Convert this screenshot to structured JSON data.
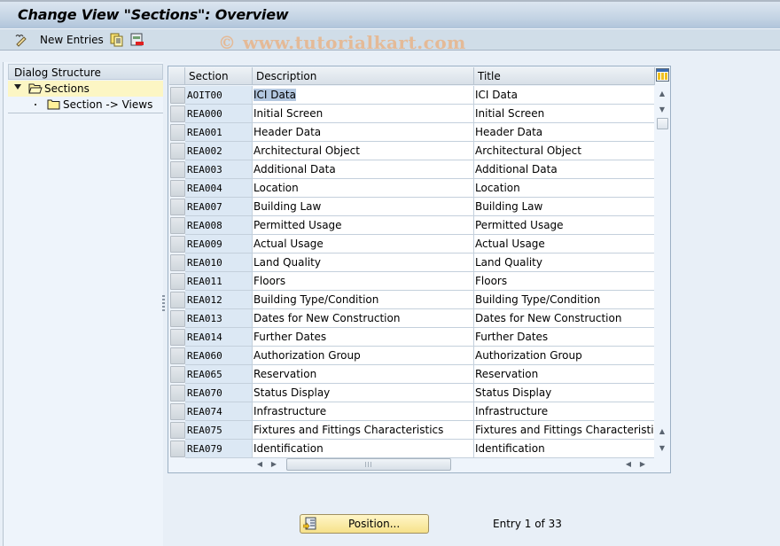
{
  "window": {
    "title": "Change View \"Sections\": Overview"
  },
  "toolbar": {
    "new_entries_label": "New Entries",
    "icons": [
      "edit-pencil-icon",
      "copy-icon",
      "delete-icon"
    ],
    "watermark": "© www.tutorialkart.com"
  },
  "dialog_structure": {
    "header": "Dialog Structure",
    "items": [
      {
        "label": "Sections",
        "icon": "open-folder-icon",
        "expanded": true,
        "selected": true
      },
      {
        "label": "Section -> Views",
        "icon": "folder-icon",
        "selected": false
      }
    ]
  },
  "table": {
    "columns": [
      "Section",
      "Description",
      "Title"
    ],
    "rows": [
      {
        "section": "AOIT00",
        "description": "ICI Data",
        "title": "ICI Data"
      },
      {
        "section": "REA000",
        "description": "Initial Screen",
        "title": "Initial Screen"
      },
      {
        "section": "REA001",
        "description": "Header Data",
        "title": "Header Data"
      },
      {
        "section": "REA002",
        "description": "Architectural Object",
        "title": "Architectural Object"
      },
      {
        "section": "REA003",
        "description": "Additional Data",
        "title": "Additional Data"
      },
      {
        "section": "REA004",
        "description": "Location",
        "title": "Location"
      },
      {
        "section": "REA007",
        "description": "Building Law",
        "title": "Building Law"
      },
      {
        "section": "REA008",
        "description": "Permitted Usage",
        "title": "Permitted Usage"
      },
      {
        "section": "REA009",
        "description": "Actual Usage",
        "title": "Actual Usage"
      },
      {
        "section": "REA010",
        "description": "Land Quality",
        "title": "Land Quality"
      },
      {
        "section": "REA011",
        "description": "Floors",
        "title": "Floors"
      },
      {
        "section": "REA012",
        "description": "Building Type/Condition",
        "title": "Building Type/Condition"
      },
      {
        "section": "REA013",
        "description": "Dates for New Construction",
        "title": "Dates for New Construction"
      },
      {
        "section": "REA014",
        "description": "Further Dates",
        "title": "Further Dates"
      },
      {
        "section": "REA060",
        "description": "Authorization Group",
        "title": "Authorization Group"
      },
      {
        "section": "REA065",
        "description": "Reservation",
        "title": "Reservation"
      },
      {
        "section": "REA070",
        "description": "Status Display",
        "title": "Status Display"
      },
      {
        "section": "REA074",
        "description": "Infrastructure",
        "title": "Infrastructure"
      },
      {
        "section": "REA075",
        "description": "Fixtures and Fittings Characteristics",
        "title": "Fixtures and Fittings Characteristics"
      },
      {
        "section": "REA079",
        "description": "Identification",
        "title": "Identification"
      }
    ]
  },
  "footer": {
    "position_button": "Position...",
    "entry_info": "Entry 1 of 33"
  }
}
